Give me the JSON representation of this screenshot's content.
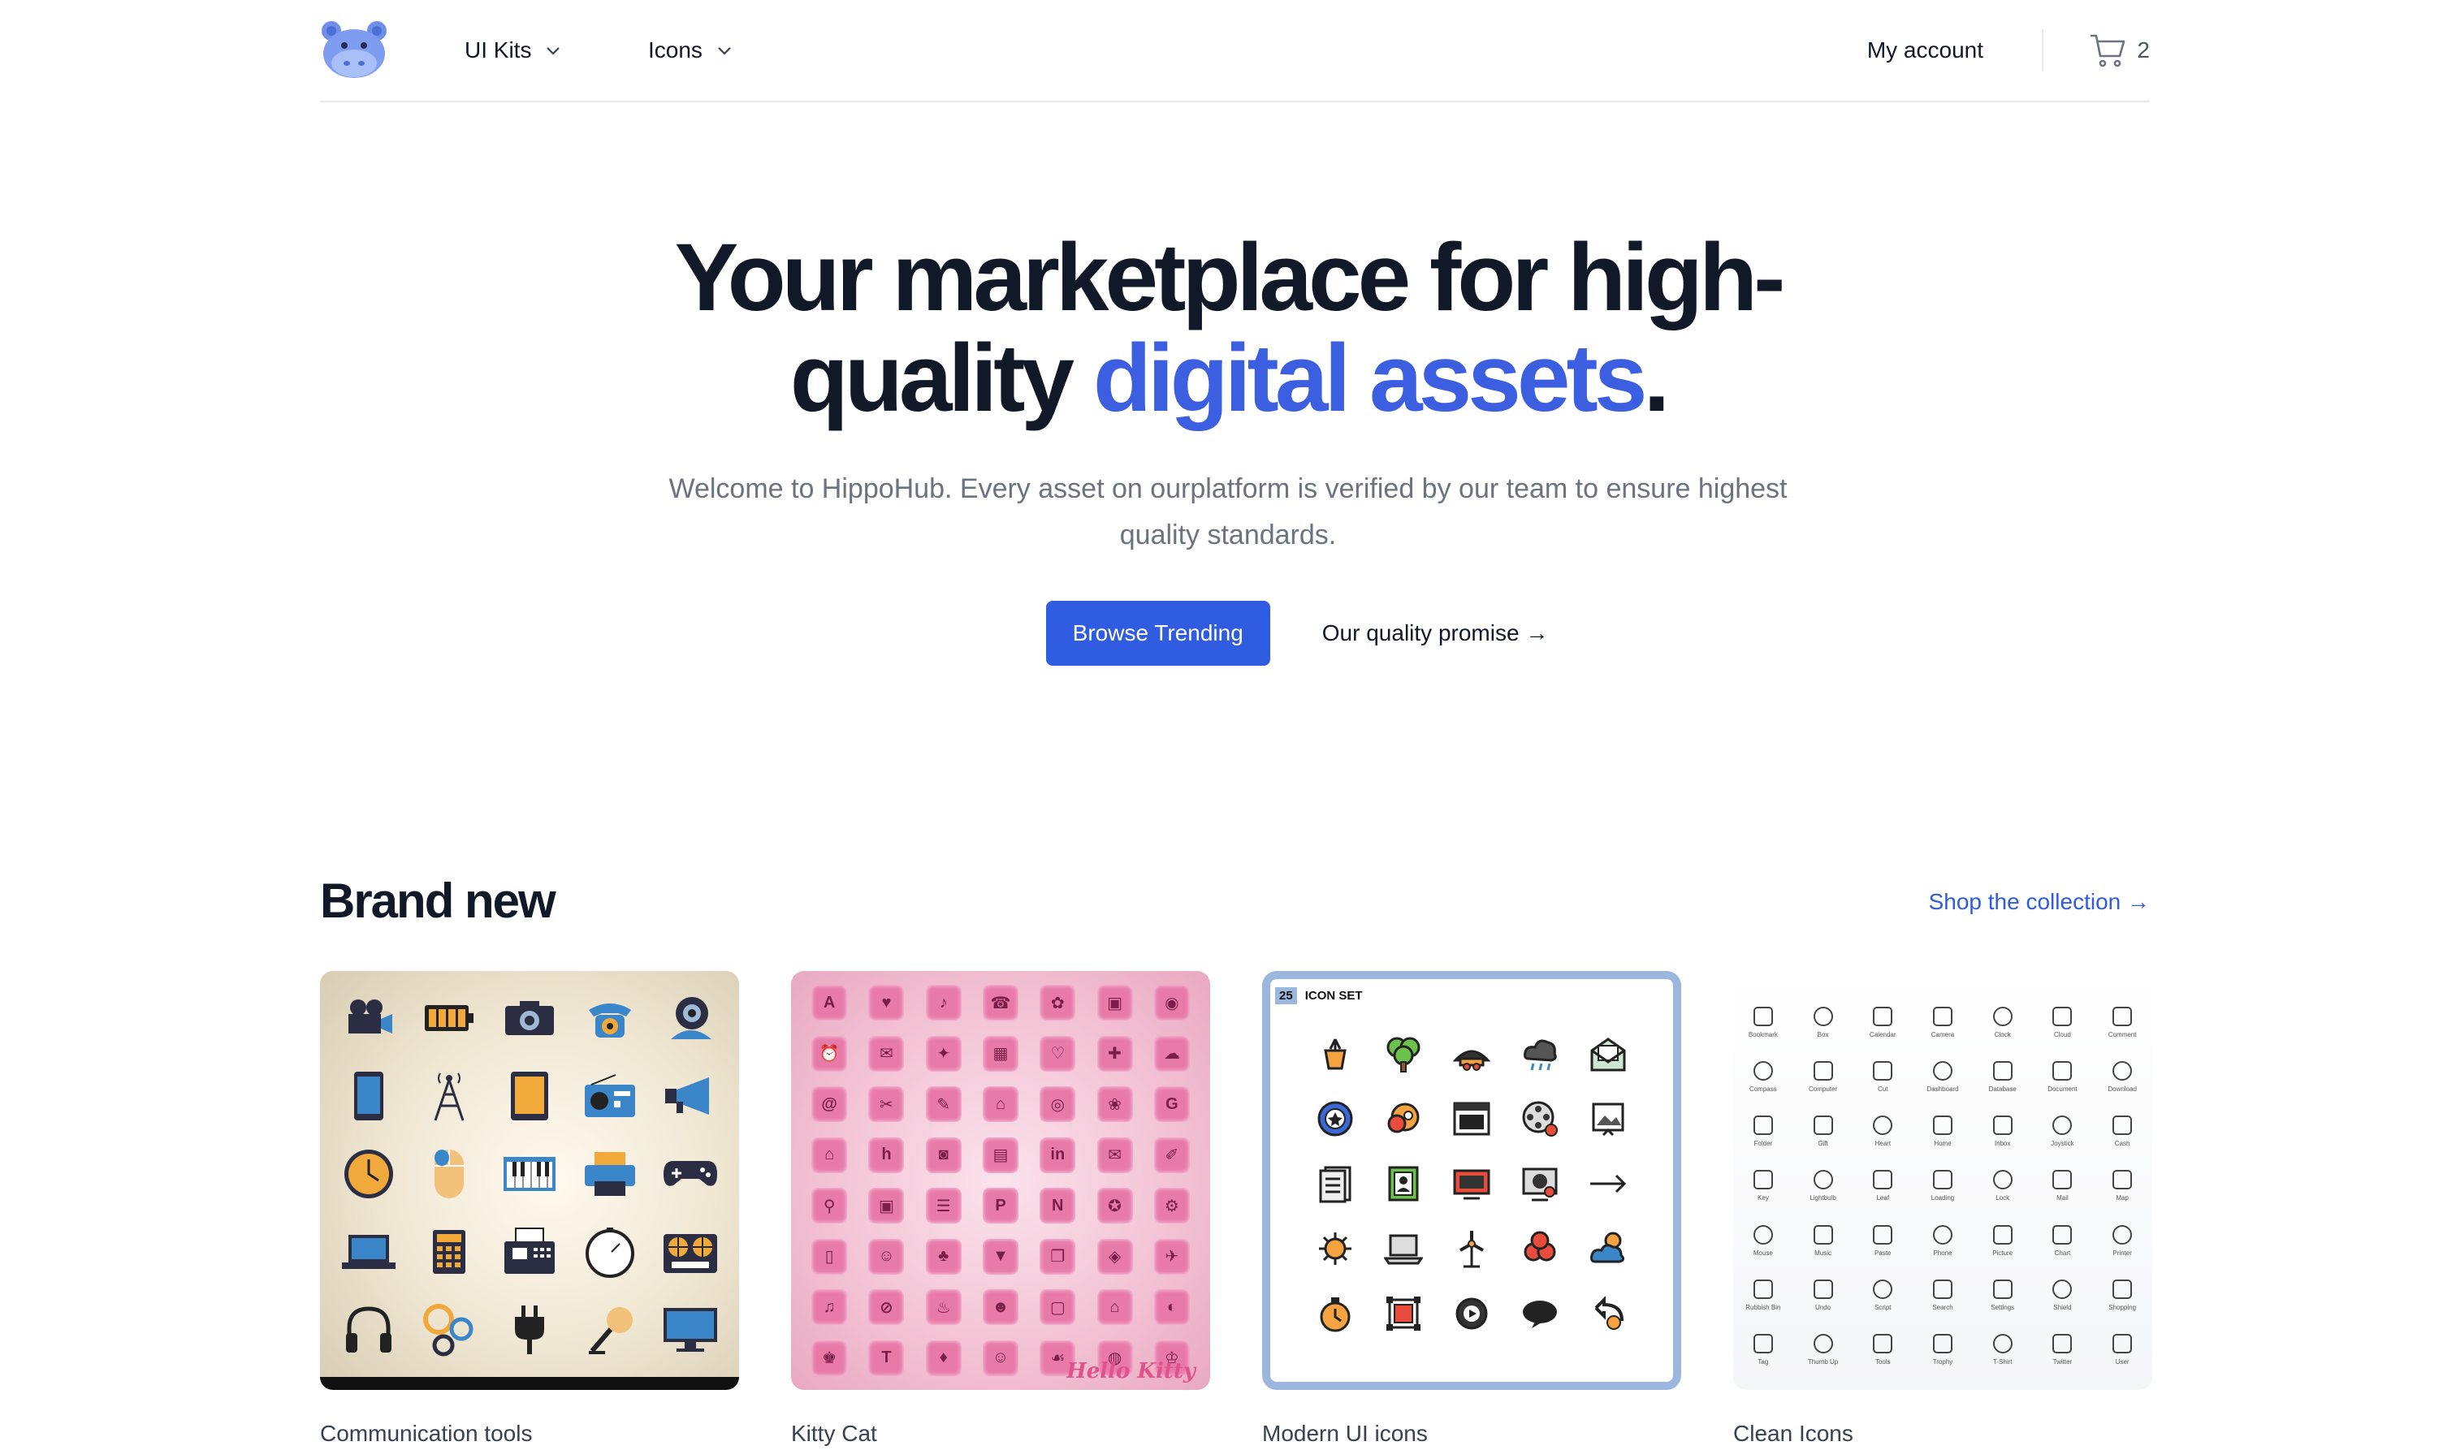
{
  "nav": {
    "menus": [
      "UI Kits",
      "Icons"
    ],
    "account": "My account",
    "cart_count": "2"
  },
  "hero": {
    "title_part1": "Your marketplace for high-quality",
    "title_accent": "digital assets",
    "title_end": ".",
    "subtitle": "Welcome to HippoHub. Every asset on ourplatform is verified by our team to ensure highest quality standards.",
    "primary_cta": "Browse Trending",
    "secondary_cta": "Our quality promise →"
  },
  "section": {
    "title": "Brand new",
    "link": "Shop the collection →"
  },
  "products": [
    {
      "name": "Communication tools"
    },
    {
      "name": "Kitty Cat"
    },
    {
      "name": "Modern UI icons"
    },
    {
      "name": "Clean Icons"
    }
  ],
  "thumb_text": {
    "modern_badge_num": "25",
    "modern_badge_text": "ICON SET",
    "kitty_watermark": "Hello Kitty",
    "clean_labels": [
      "Bookmark",
      "Box",
      "Calendar",
      "Camera",
      "Clock",
      "Cloud",
      "Comment",
      "Compass",
      "Computer",
      "Cut",
      "Dashboard",
      "Database",
      "Document",
      "Download",
      "Folder",
      "Gift",
      "Heart",
      "Home",
      "Inbox",
      "Joystick",
      "Cash",
      "Key",
      "Lightbulb",
      "Leaf",
      "Loading",
      "Lock",
      "Mail",
      "Map",
      "Mouse",
      "Music",
      "Paste",
      "Phone",
      "Picture",
      "Chart",
      "Printer",
      "Rubbish Bin",
      "Undo",
      "Script",
      "Search",
      "Settings",
      "Shield",
      "Shopping",
      "Tag",
      "Thumb Up",
      "Tools",
      "Trophy",
      "T-Shirt",
      "Twitter",
      "User"
    ]
  },
  "colors": {
    "brand_blue": "#2f5ce0",
    "accent_text": "#3b5fe0",
    "heading": "#111827",
    "muted": "#6b7280"
  },
  "icons": [
    "hippo-logo",
    "chevron-down-icon",
    "cart-icon"
  ]
}
